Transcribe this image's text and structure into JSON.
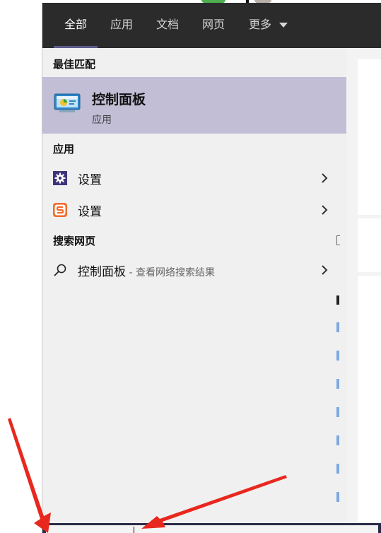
{
  "tabs": [
    "全部",
    "应用",
    "文档",
    "网页",
    "更多"
  ],
  "sections": {
    "best_match": "最佳匹配",
    "apps": "应用",
    "web": "搜索网页"
  },
  "best_match": {
    "title": "控制面板",
    "subtitle": "应用",
    "icon": "control-panel-icon"
  },
  "apps": [
    {
      "label": "设置",
      "icon": "gear-icon"
    },
    {
      "label": "设置",
      "icon": "sogou-s-icon"
    }
  ],
  "web_result": {
    "query": "控制面板",
    "hint": " - 查看网络搜索结果",
    "icon": "search-icon"
  },
  "colors": {
    "tabbar": "#2b2b2b",
    "highlight": "#c2bed6",
    "panel": "#f0f0f0",
    "annotation_arrow": "#e8281e"
  }
}
